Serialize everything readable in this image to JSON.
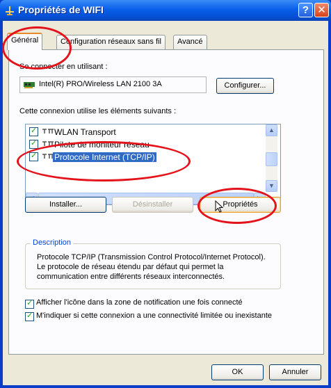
{
  "window": {
    "title": "Propriétés de WIFI",
    "help_label": "?",
    "close_label": "✕"
  },
  "tabs": [
    {
      "label": "Général",
      "active": true
    },
    {
      "label": "Configuration réseaux sans fil",
      "active": false
    },
    {
      "label": "Avancé",
      "active": false
    }
  ],
  "general": {
    "connect_using_label": "Se connecter en utilisant :",
    "adapter_name": "Intel(R) PRO/Wireless LAN 2100 3A",
    "configure_button": "Configurer...",
    "components_label": "Cette connexion utilise les éléments suivants :",
    "components": [
      {
        "label": "WLAN Transport",
        "checked": true,
        "selected": false
      },
      {
        "label": "Pilote de moniteur réseau",
        "checked": true,
        "selected": false
      },
      {
        "label": "Protocole Internet (TCP/IP)",
        "checked": true,
        "selected": true
      }
    ],
    "install_button": "Installer...",
    "uninstall_button": "Désinstaller",
    "properties_button": "Propriétés",
    "description": {
      "title": "Description",
      "text": "Protocole TCP/IP (Transmission Control Protocol/Internet Protocol). Le protocole de réseau étendu par défaut qui permet la communication entre différents réseaux interconnectés."
    },
    "show_icon_label": "Afficher l'icône dans la zone de notification une fois connecté",
    "show_icon_checked": true,
    "notify_limited_label": "M'indiquer si cette connexion a une connectivité limitée ou inexistante",
    "notify_limited_checked": true
  },
  "footer": {
    "ok_button": "OK",
    "cancel_button": "Annuler"
  },
  "colors": {
    "annotation": "#e4121b",
    "selection": "#316ac5",
    "title_bar": "#0a5fe8",
    "dialog_bg": "#ece9d8"
  }
}
